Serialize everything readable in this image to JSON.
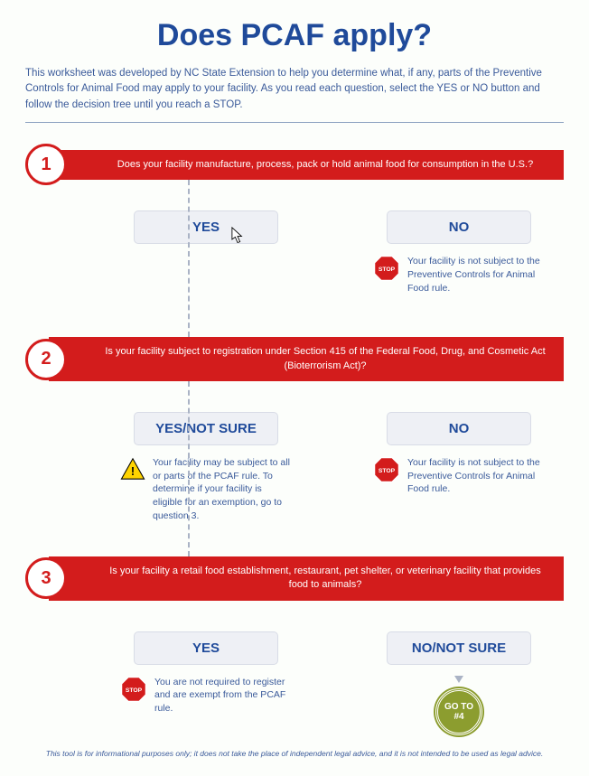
{
  "title": "Does PCAF apply?",
  "intro": "This worksheet was developed by NC State Extension to help you determine what, if any, parts of the Preventive Controls for Animal Food may apply to your facility. As you read each question, select the YES or NO button and follow the decision tree until you reach a STOP.",
  "questions": [
    {
      "num": "1",
      "text": "Does your facility manufacture, process, pack or hold animal food for consumption in the U.S.?",
      "yes": {
        "label": "YES",
        "outcome": ""
      },
      "no": {
        "label": "NO",
        "outcome": "Your facility is not subject to the Preventive Controls for Animal Food rule."
      }
    },
    {
      "num": "2",
      "text": "Is your facility subject to registration under Section 415 of the Federal Food, Drug, and Cosmetic Act (Bioterrorism Act)?",
      "yes": {
        "label": "YES/NOT SURE",
        "outcome": "Your facility may be subject to all or parts of the PCAF rule. To determine if your facility is eligible for an exemption, go to question 3."
      },
      "no": {
        "label": "NO",
        "outcome": "Your facility is not subject to the Preventive Controls for Animal Food rule."
      }
    },
    {
      "num": "3",
      "text": "Is your facility a retail food establishment, restaurant, pet shelter, or veterinary facility that provides food to animals?",
      "yes": {
        "label": "YES",
        "outcome": "You are not required to register and are exempt from the PCAF rule."
      },
      "no": {
        "label": "NO/NOT SURE",
        "outcome": ""
      }
    }
  ],
  "goto": {
    "line1": "GO TO",
    "line2": "#4"
  },
  "footer": "This tool is for informational purposes only; it does not take the place of independent legal advice, and it is not intended to be used as legal advice.",
  "colors": {
    "red": "#d31c1c",
    "blue": "#1f4a9a",
    "olive": "#8c9d2f"
  }
}
